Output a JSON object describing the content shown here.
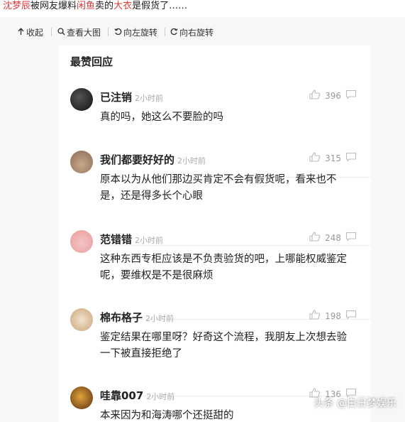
{
  "headline": {
    "seg1": "沈梦辰",
    "seg2": "被网友爆料",
    "seg3": "闲鱼",
    "seg4": "卖的",
    "seg5": "大衣",
    "seg6": "是假货了……"
  },
  "toolbar": {
    "collapse": "收起",
    "view_large": "查看大图",
    "rotate_left": "向左旋转",
    "rotate_right": "向右旋转"
  },
  "panel": {
    "section_title": "最赞回应"
  },
  "comments": [
    {
      "user": "已注销",
      "time": "2小时前",
      "likes": "396",
      "text": "真的吗，她这么不要脸的吗"
    },
    {
      "user": "我们都要好好的",
      "time": "2小时前",
      "likes": "315",
      "text": "原本以为从他们那边买肯定不会有假货呢，看来也不是，还是得多长个心眼"
    },
    {
      "user": "范错错",
      "time": "2小时前",
      "likes": "248",
      "text": "这种东西专柜应该是不负责验货的吧，上哪能权威鉴定呢，要维权是不是很麻烦"
    },
    {
      "user": "棉布格子",
      "time": "2小时前",
      "likes": "198",
      "text": "鉴定结果在哪里呀？好奇这个流程，我朋友上次想去验一下被直接拒绝了"
    },
    {
      "user": "哇靠007",
      "time": "2小时前",
      "likes": "136",
      "text": "本来因为和海涛哪个还挺甜的"
    }
  ],
  "watermark": "头条 @白日梦娱乐",
  "colors": {
    "accent_red": "#e23a3a",
    "text_muted": "#aaaaaa"
  }
}
